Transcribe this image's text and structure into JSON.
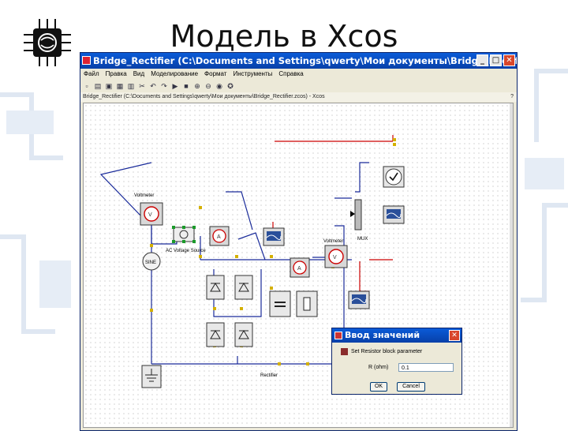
{
  "slide": {
    "title": "Модель в Xcos"
  },
  "window": {
    "title": "Bridge_Rectifier (C:\\Documents and Settings\\qwerty\\Мои документы\\Bridge_Rectifi...",
    "menu": [
      "Файл",
      "Правка",
      "Вид",
      "Моделирование",
      "Формат",
      "Инструменты",
      "Справка"
    ],
    "path": "Bridge_Rectifier (C:\\Documents and Settings\\qwerty\\Мои документы\\Bridge_Rectifier.zcos) - Xcos",
    "help_mark": "?"
  },
  "toolbar_icons": [
    "new-icon",
    "open-icon",
    "save-icon",
    "saveas-icon",
    "print-icon",
    "cut-icon",
    "undo-icon",
    "redo-icon",
    "start-icon",
    "stop-icon",
    "zoom-in-icon",
    "zoom-out-icon",
    "palette-icon",
    "help-icon"
  ],
  "diagram": {
    "labels": {
      "voltmeter_left": "Voltmeter",
      "ac_source": "AC Voltage Source",
      "sine": "SINE",
      "voltmeter_right": "Voltmeter",
      "mux": "MUX",
      "rectifier": "Rectifier"
    }
  },
  "dialog": {
    "title": "Ввод значений",
    "prompt": "Set Resistor block parameter",
    "field_label": "R (ohm)",
    "field_value": "0.1",
    "ok": "OK",
    "cancel": "Cancel"
  },
  "colors": {
    "titlebar": "#0a5bd8",
    "link_blue": "#1a2b9a",
    "link_red": "#cc0000",
    "port_yellow": "#d4b000"
  }
}
